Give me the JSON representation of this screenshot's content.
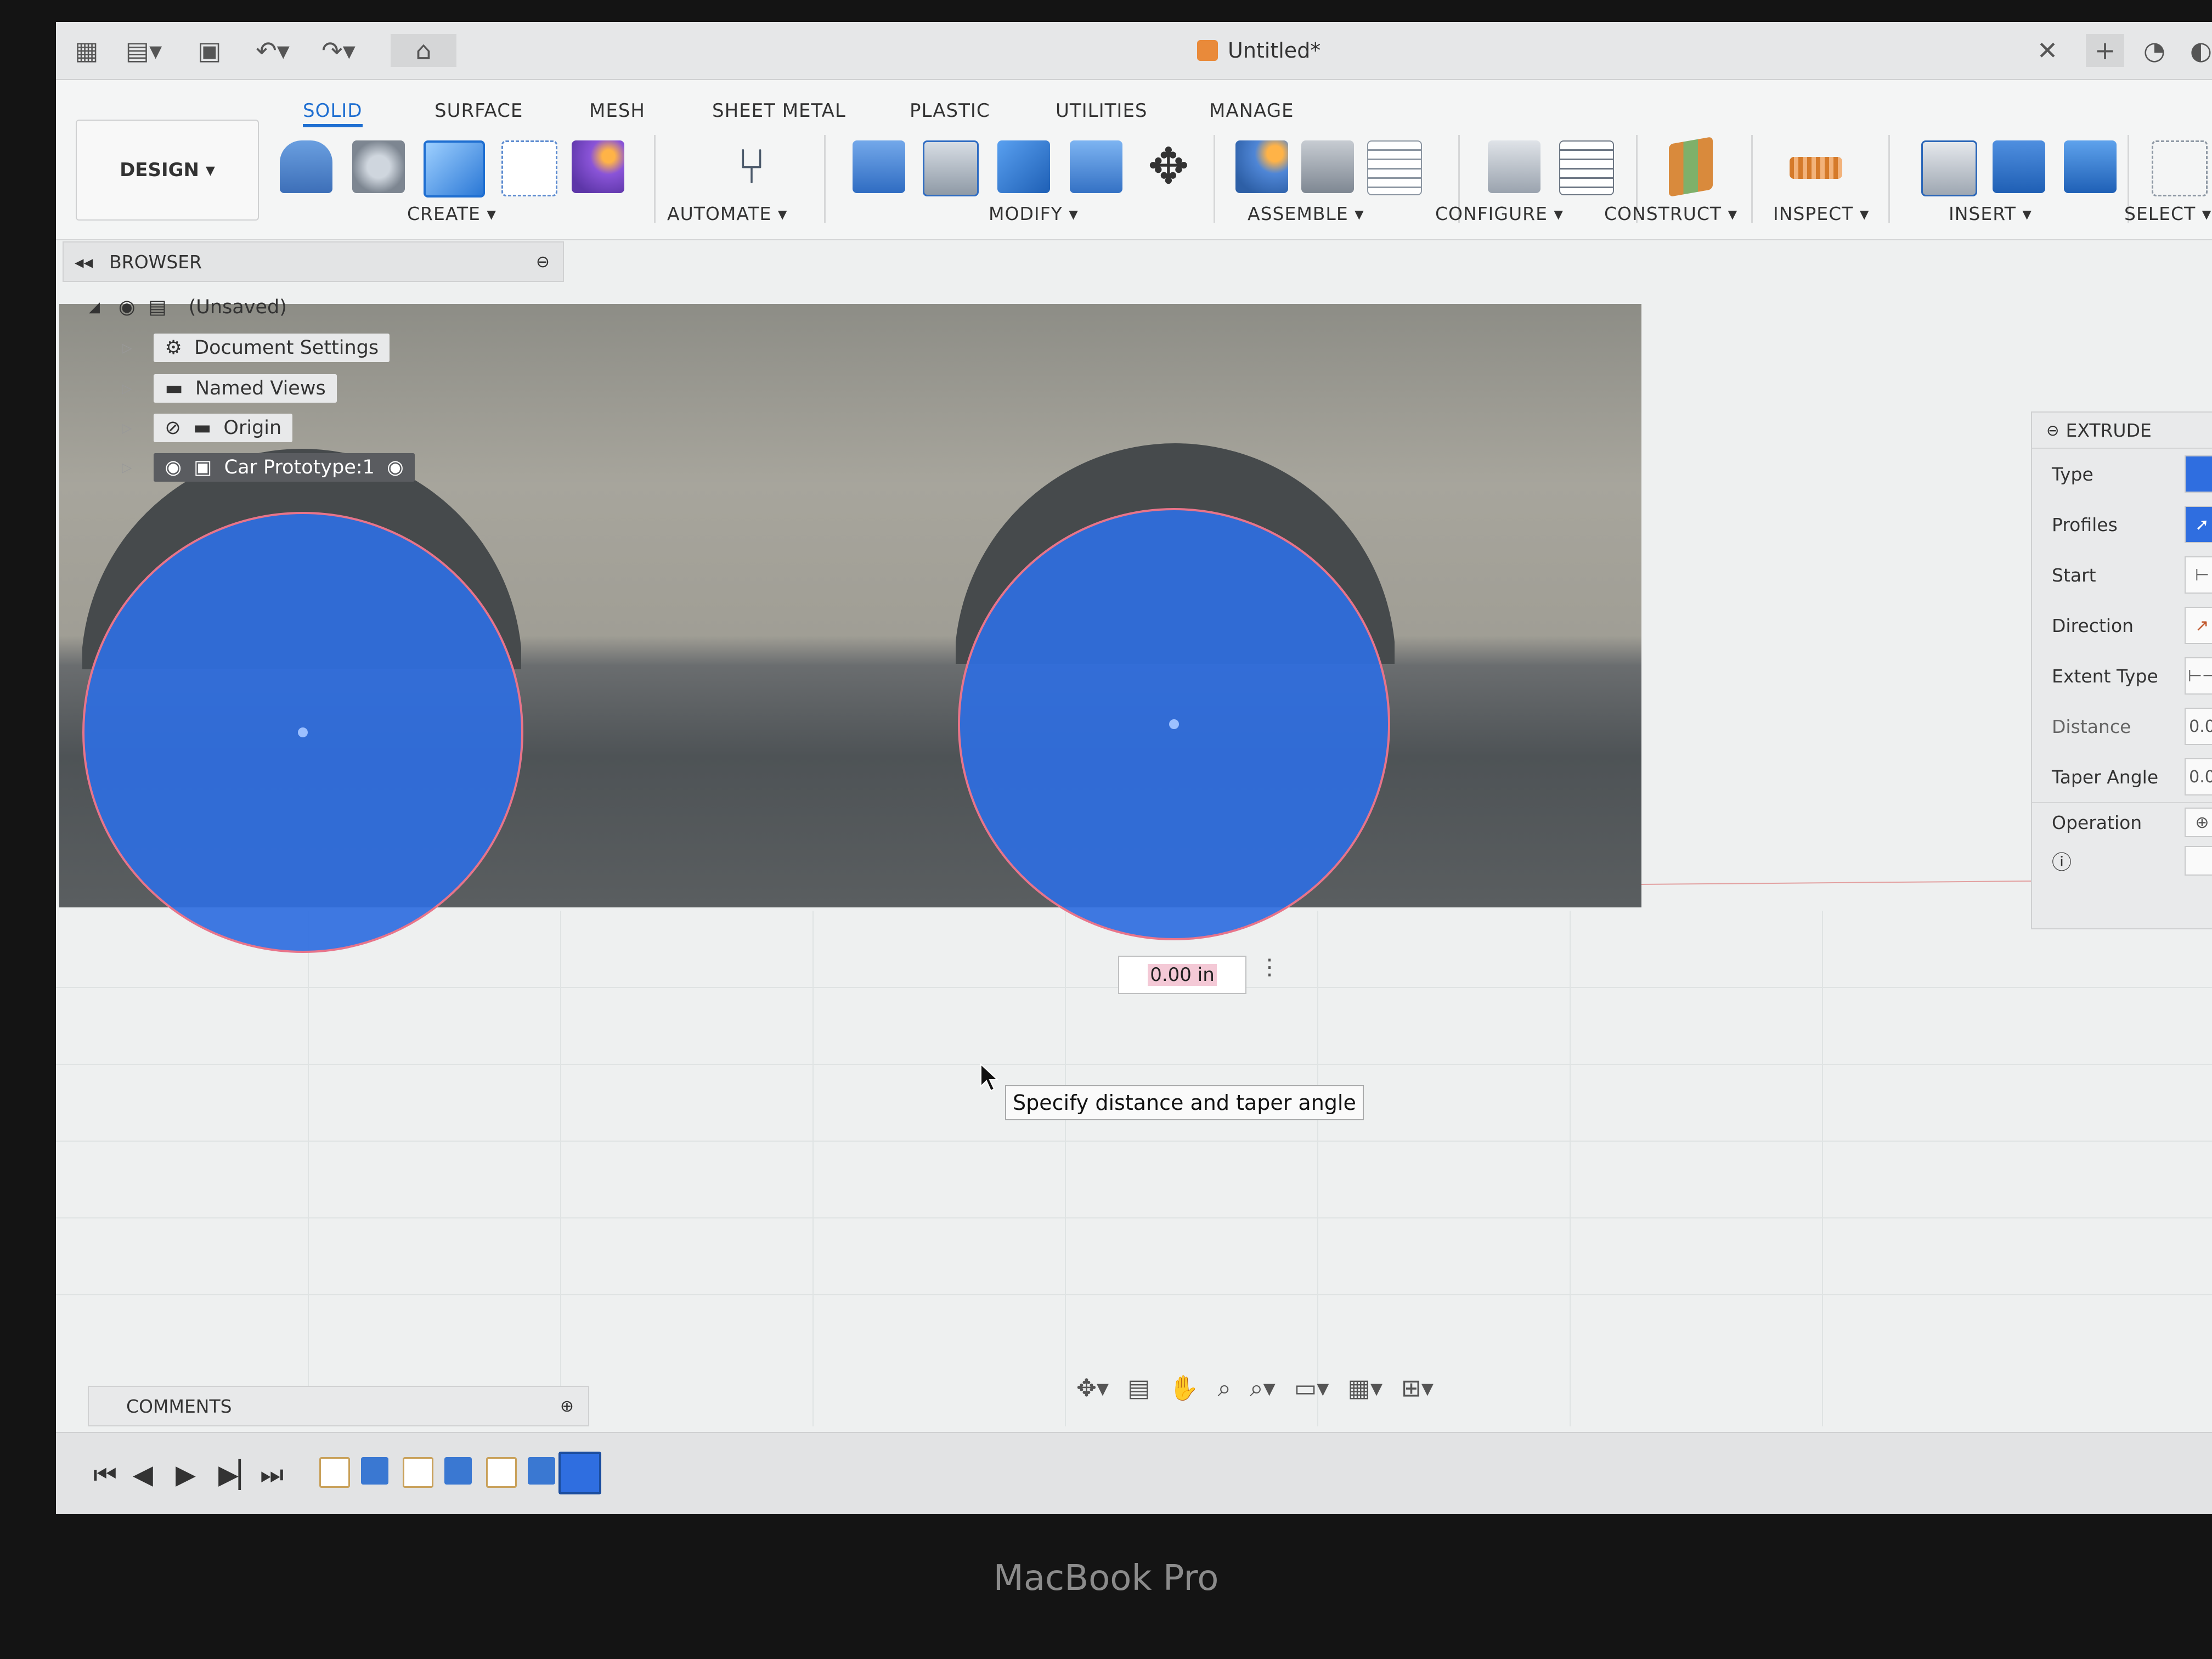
{
  "window": {
    "title": "Untitled*"
  },
  "workspace": {
    "label": "DESIGN"
  },
  "tabs": [
    {
      "label": "SOLID",
      "active": true
    },
    {
      "label": "SURFACE"
    },
    {
      "label": "MESH"
    },
    {
      "label": "SHEET METAL"
    },
    {
      "label": "PLASTIC"
    },
    {
      "label": "UTILITIES"
    },
    {
      "label": "MANAGE"
    }
  ],
  "toolbar_groups": [
    "CREATE",
    "AUTOMATE",
    "MODIFY",
    "ASSEMBLE",
    "CONFIGURE",
    "CONSTRUCT",
    "INSPECT",
    "INSERT",
    "SELECT"
  ],
  "browser": {
    "title": "BROWSER",
    "root": "(Unsaved)",
    "items": [
      "Document Settings",
      "Named Views",
      "Origin",
      "Car Prototype:1"
    ]
  },
  "extrude": {
    "title": "EXTRUDE",
    "rows": [
      {
        "label": "Type",
        "value": ""
      },
      {
        "label": "Profiles",
        "value": ""
      },
      {
        "label": "Start",
        "value": ""
      },
      {
        "label": "Direction",
        "value": ""
      },
      {
        "label": "Extent Type",
        "value": ""
      },
      {
        "label": "Distance",
        "value": "0.0"
      },
      {
        "label": "Taper Angle",
        "value": "0.0"
      },
      {
        "label": "Operation",
        "value": ""
      }
    ]
  },
  "distance_input": {
    "value": "0.00 in"
  },
  "tooltip": {
    "text": "Specify distance and taper angle"
  },
  "comments": {
    "title": "COMMENTS"
  },
  "bezel": {
    "label": "MacBook Pro"
  },
  "colors": {
    "accent": "#1f6fd1",
    "profile": "#2f6ee0",
    "selected_row": "#5a5c60"
  }
}
